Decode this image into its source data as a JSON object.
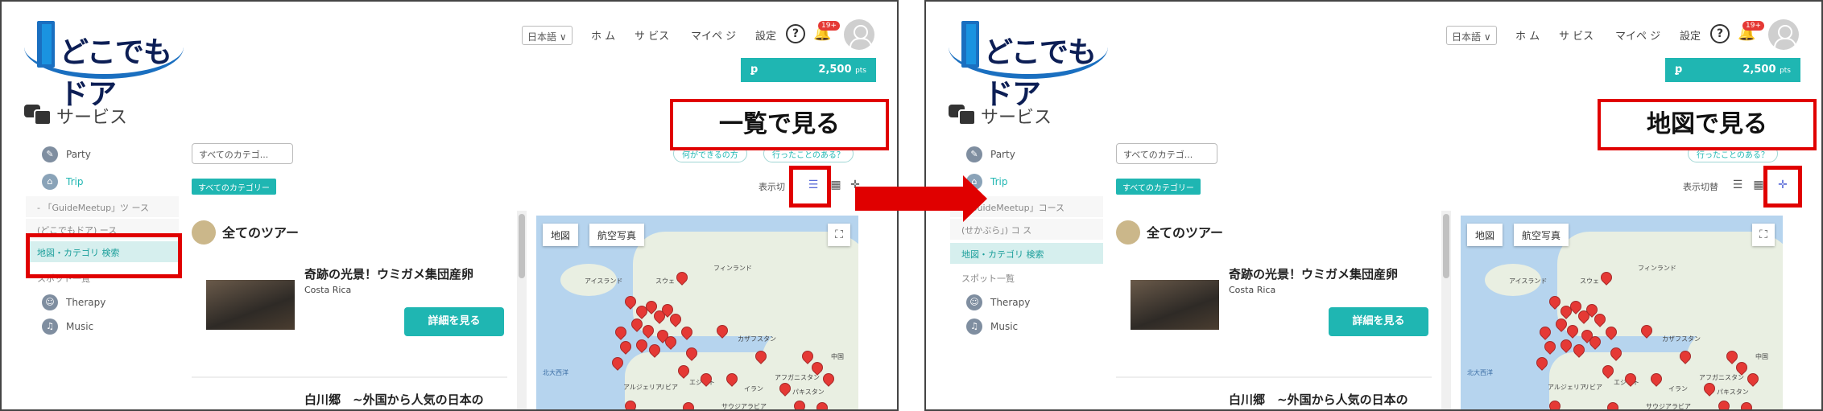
{
  "header": {
    "logo_text": "どこでもドア",
    "language": "日本語 ∨",
    "nav": [
      "ホ ム",
      "サ ビス",
      "マイペ ジ",
      "設定"
    ],
    "help_label": "?",
    "bell_badge": "19+",
    "points": "2,500",
    "points_unit": "pts",
    "points_symbol": "ꝑ"
  },
  "page_title": "サービス",
  "sidebar": {
    "items": [
      {
        "label": "Party",
        "icon": "party-icon"
      },
      {
        "label": "Trip",
        "icon": "trip-icon"
      },
      {
        "label": "Therapy",
        "icon": "therapy-icon"
      },
      {
        "label": "Music",
        "icon": "music-icon"
      }
    ],
    "left_subitems": [
      "- 「GuideMeetup」ツ ース",
      "(どこでもドア) ース",
      "地図・カテゴリ 検索",
      "スポット一覧"
    ],
    "right_subitems": [
      "「GuideMeetup」コース",
      "(せかぶら」) コ ス",
      "地図・カテゴリ 検索",
      "スポット一覧"
    ]
  },
  "filters": {
    "category_select": "すべてのカテゴ...",
    "chips": [
      "何ができるの方",
      "行ったことのある？"
    ],
    "category_tag": "すべてのカテゴリー",
    "view_label_left": "表示切",
    "view_label_right": "表示切替"
  },
  "content": {
    "heading": "全てのツアー",
    "tours": [
      {
        "title": "奇跡の光景！ウミガメ集団産卵",
        "location": "Costa Rica",
        "button": "詳細を見る"
      },
      {
        "title": "白川郷　~外国から人気の日本の"
      }
    ]
  },
  "map": {
    "tabs": [
      "地図",
      "航空写真"
    ],
    "fullscreen_icon": "⛶",
    "labels": [
      "アイスランド",
      "スウェ ",
      "フィンランド",
      "カザフスタン",
      "北大西洋",
      "アルジェリア",
      "リビア",
      "エジプト",
      "アフガニスタン",
      "パキスタン",
      "サウジアラビア",
      "イラン",
      "中国"
    ]
  },
  "annotations": {
    "left_callout": "一覧で見る",
    "right_callout": "地図で見る"
  },
  "colors": {
    "accent": "#1fb6b2",
    "annotation": "#e00000",
    "map_water": "#b6d4ee",
    "pin": "#e53935"
  }
}
